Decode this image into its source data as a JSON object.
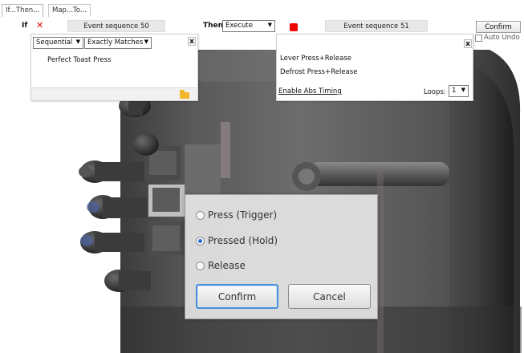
{
  "tabs": [
    {
      "label": "If...Then..."
    },
    {
      "label": "Map...To..."
    }
  ],
  "rule": {
    "if_label": "If",
    "if_sequence": "Event sequence 50",
    "then_label": "Then",
    "then_action": "Execute",
    "then_sequence": "Event sequence 51",
    "confirm_label": "Confirm",
    "auto_undo_label": "Auto Undo"
  },
  "if_panel": {
    "order_mode": "Sequential",
    "match_mode": "Exactly Matches",
    "items": [
      "Perfect Toast Press"
    ]
  },
  "then_panel": {
    "items": [
      "Lever Press+Release",
      "Defrost Press+Release"
    ],
    "abs_timing_label": "Enable Abs Timing",
    "loops_label": "Loops:",
    "loops_value": "1"
  },
  "dialog": {
    "options": [
      {
        "label": "Press (Trigger)",
        "selected": false
      },
      {
        "label": "Pressed (Hold)",
        "selected": true
      },
      {
        "label": "Release",
        "selected": false
      }
    ],
    "confirm_label": "Confirm",
    "cancel_label": "Cancel"
  },
  "icons": {
    "delete_condition": "red-x-icon",
    "stop": "red-stop-icon",
    "close": "close-icon",
    "folder": "folder-icon",
    "dropdown": "chevron-down-icon"
  },
  "colors": {
    "accent_red": "#e00000",
    "focus_blue": "#4a90d9",
    "folder_yellow": "#f2b62a"
  }
}
